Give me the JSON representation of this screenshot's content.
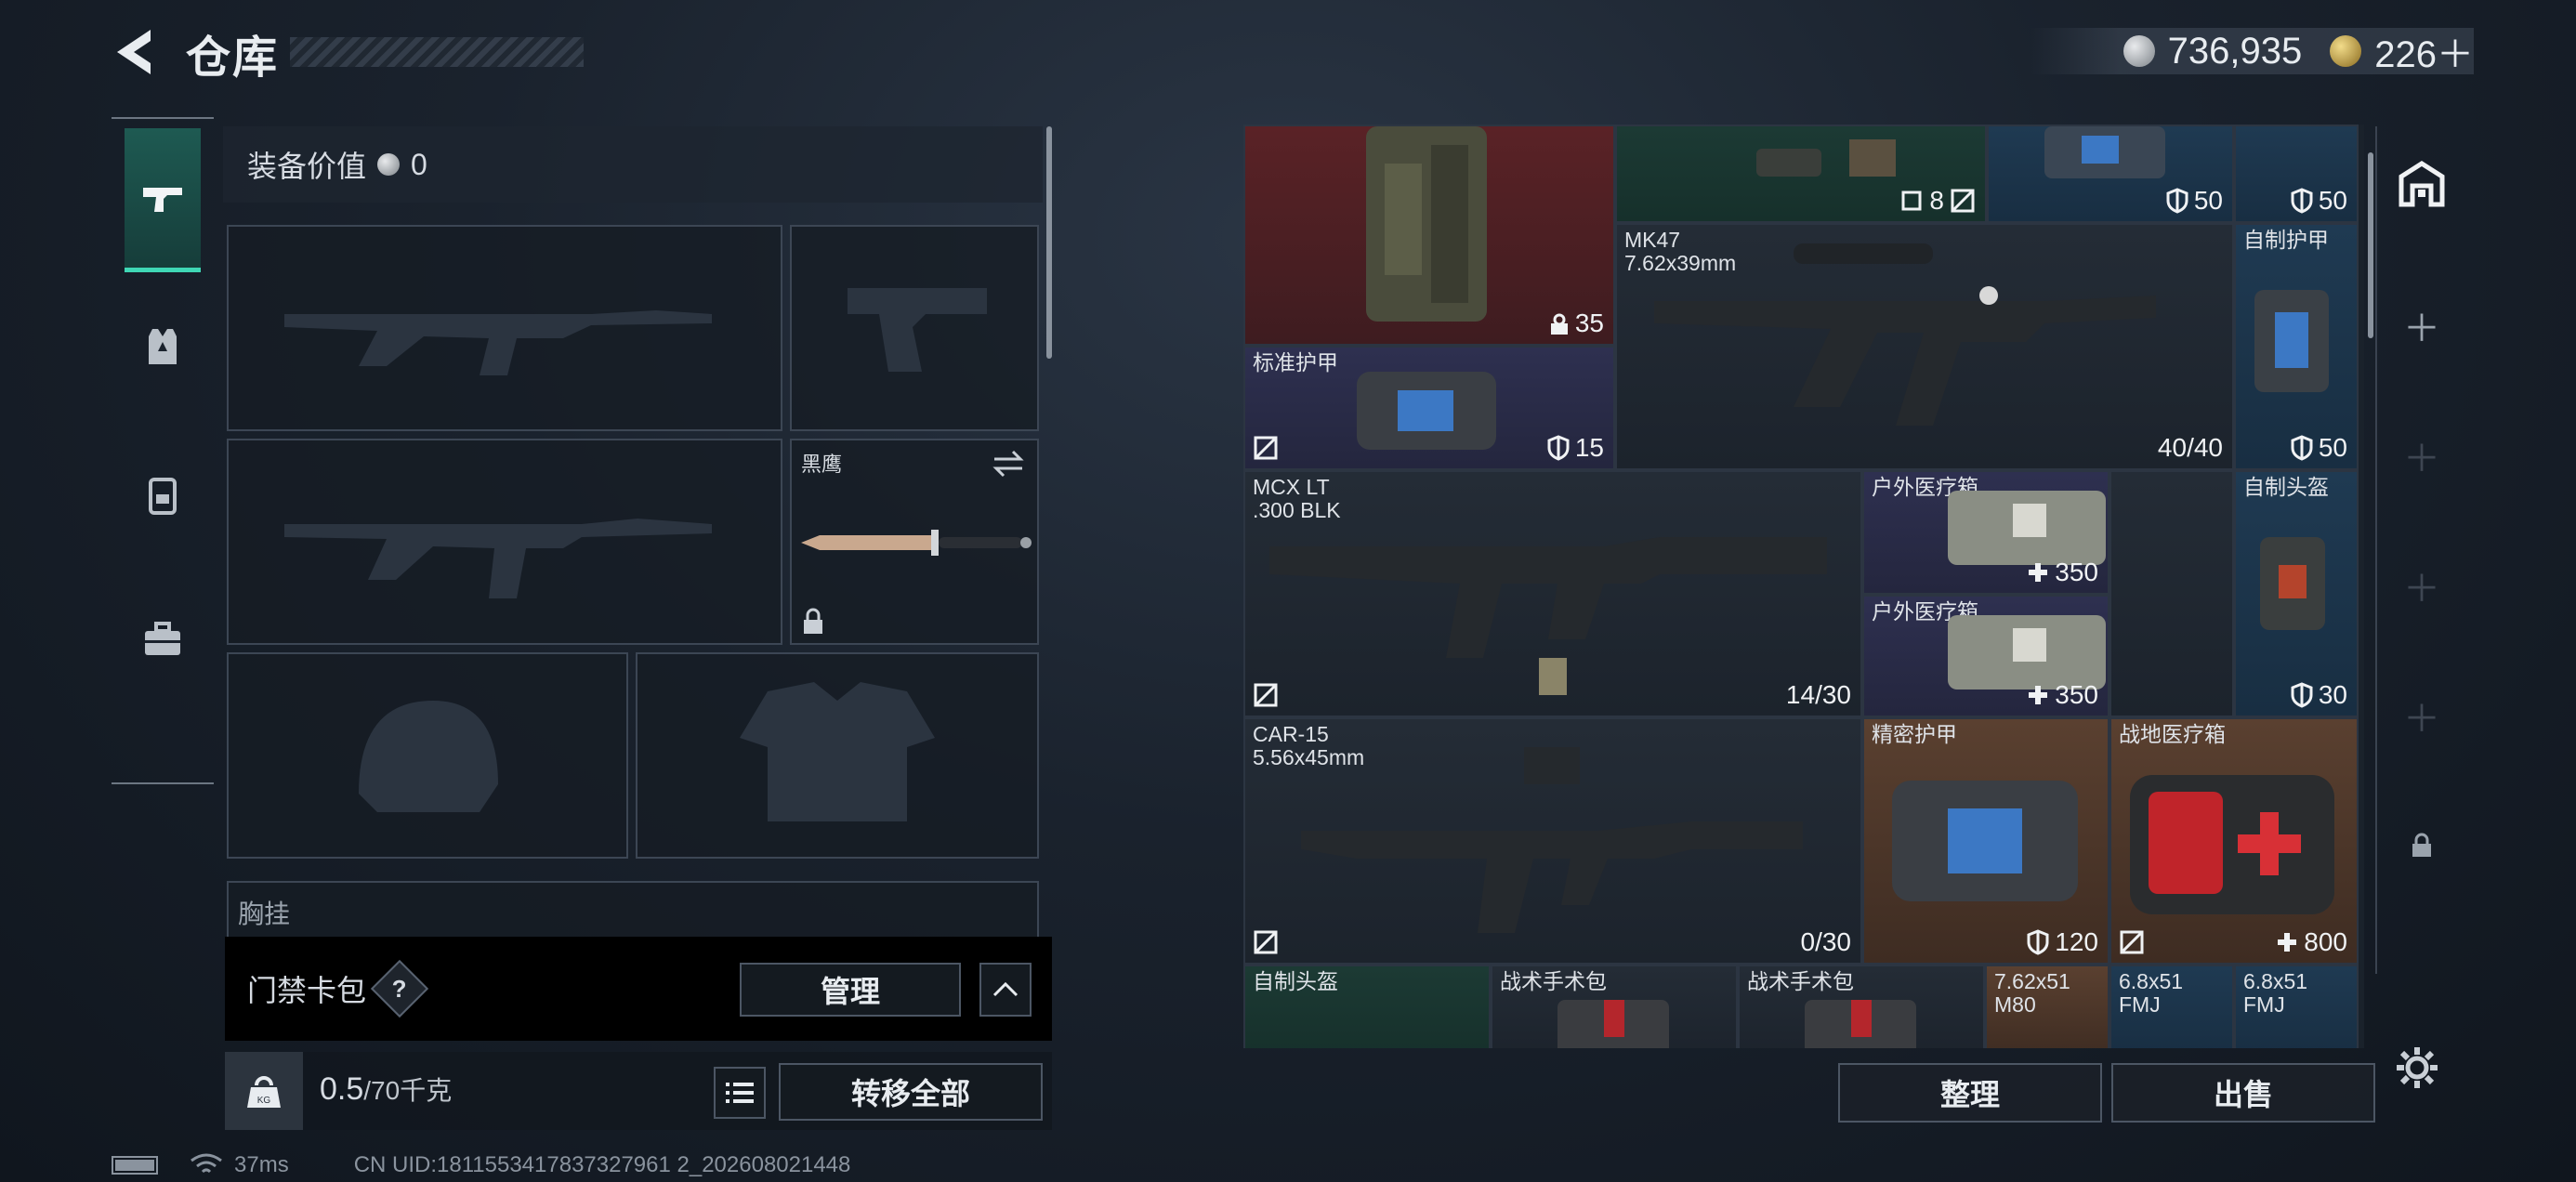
{
  "header": {
    "title": "仓库",
    "currency_silver": "736,935",
    "currency_gold": "226＋"
  },
  "loadout": {
    "value_label": "装备价值",
    "value": "0",
    "knife_label": "黑鹰",
    "chest_label": "胸挂",
    "cardpack_label": "门禁卡包",
    "cardpack_help": "?",
    "manage_label": "管理",
    "weight_value": "0.5",
    "weight_cap": "/70千克",
    "transfer_all_label": "转移全部"
  },
  "grid_items": [
    {
      "id": "vest-red",
      "name": "",
      "value": "35"
    },
    {
      "id": "scope-top",
      "name": "",
      "value": "8"
    },
    {
      "id": "armor-top-blue",
      "name": "",
      "value": "50"
    },
    {
      "id": "armor-top-blue2",
      "name": "",
      "value": "50"
    },
    {
      "id": "mk47",
      "name": "MK47\n7.62x39mm",
      "value": "40/40"
    },
    {
      "id": "homemade-armor",
      "name": "自制护甲",
      "value": "50"
    },
    {
      "id": "std-armor",
      "name": "标准护甲",
      "value": "15"
    },
    {
      "id": "mcx",
      "name": "MCX LT\n.300 BLK",
      "value": "14/30"
    },
    {
      "id": "outdoor-med-1",
      "name": "户外医疗箱",
      "value": "350"
    },
    {
      "id": "homemade-helmet",
      "name": "自制头盔",
      "value": "30"
    },
    {
      "id": "outdoor-med-2",
      "name": "户外医疗箱",
      "value": "350"
    },
    {
      "id": "car15",
      "name": "CAR-15\n5.56x45mm",
      "value": "0/30"
    },
    {
      "id": "precision-armor",
      "name": "精密护甲",
      "value": "120"
    },
    {
      "id": "field-med",
      "name": "战地医疗箱",
      "value": "800"
    },
    {
      "id": "helmet-b",
      "name": "自制头盔",
      "value": ""
    },
    {
      "id": "tac-kit-1",
      "name": "战术手术包",
      "value": ""
    },
    {
      "id": "tac-kit-2",
      "name": "战术手术包",
      "value": ""
    },
    {
      "id": "ammo-1",
      "name": "7.62x51\nM80",
      "value": ""
    },
    {
      "id": "ammo-2",
      "name": "6.8x51\nFMJ",
      "value": ""
    },
    {
      "id": "ammo-3",
      "name": "6.8x51\nFMJ",
      "value": ""
    }
  ],
  "actions": {
    "sort_label": "整理",
    "sell_label": "出售"
  },
  "footer": {
    "ping": "37ms",
    "uid": "CN UID:1811553417837327961 2_202608021448"
  },
  "colors": {
    "accent": "#3fd7b5",
    "red_tier": "#5a2226",
    "blue_tier": "#1f3a52",
    "gold_tier": "#5a4030"
  }
}
